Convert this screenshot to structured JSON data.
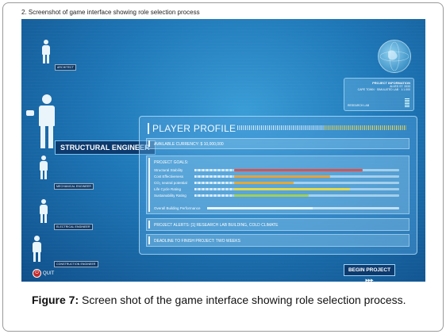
{
  "figure_header": "2. Screenshot of game interface showing role selection process",
  "roles": [
    {
      "label": "ARCHITECT"
    },
    {
      "label": "STRUCTURAL ENGINEER"
    },
    {
      "label": "MECHANICAL ENGINEER"
    },
    {
      "label": "ELECTRICAL ENGINEER"
    },
    {
      "label": "CONSTRUCTION ENGINEER"
    }
  ],
  "quit_label": "QUIT",
  "project_info": {
    "title": "PROJECT INFORMATION",
    "line1": "ALVES ST. 3333",
    "line2": "CAPE TOWN · SIMULATED LAB · 1:1.000",
    "lab": "RESEARCH LAB"
  },
  "profile": {
    "title": "PLAYER PROFILE",
    "currency": "AVAILABLE CURRENCY: $ 10,000,000",
    "goals_heading": "PROJECT GOALS:",
    "goals": [
      {
        "name": "Structural Stability",
        "value": 0.78,
        "color": "#d9534f"
      },
      {
        "name": "Cost Effectiveness",
        "value": 0.58,
        "color": "#e8a13a"
      },
      {
        "name": "CO₂ neutral potential",
        "value": 0.36,
        "color": "#e0a93c"
      },
      {
        "name": "Life Cycle Rating",
        "value": 0.7,
        "color": "#e6d94a"
      },
      {
        "name": "Sustainability Rating",
        "value": 0.45,
        "color": "#9fcf5a"
      }
    ],
    "overall_label": "Overall Building Performance",
    "overall_value": 0.55,
    "alerts": "PROJECT ALERTS: [1] RESEARCH LAB  BUILDING, COLD CLIMATE",
    "deadline": "DEADLINE TO FINISH PROJECT:  TWO WEEKS"
  },
  "begin_label": "BEGIN PROJECT ▸▸▸",
  "caption_bold": "Figure 7:",
  "caption_text": " Screen shot of the game interface showing role selection process."
}
